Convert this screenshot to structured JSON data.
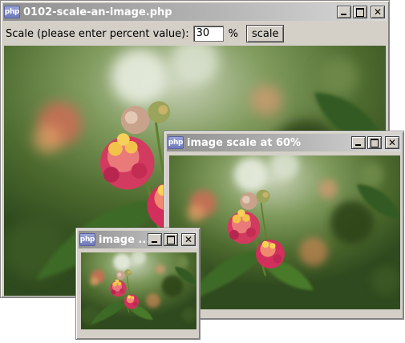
{
  "main_window": {
    "title": "0102-scale-an-image.php",
    "scale_label": "Scale (please enter percent value):",
    "scale_value": "30",
    "percent_sign": "%",
    "scale_button": "scale"
  },
  "window_60": {
    "title": "image scale at 60%"
  },
  "window_30": {
    "title": "image ..."
  },
  "logo_text": "php",
  "titlebar_buttons": {
    "minimize": "minimize-icon",
    "maximize": "maximize-icon",
    "close": "close-icon"
  }
}
